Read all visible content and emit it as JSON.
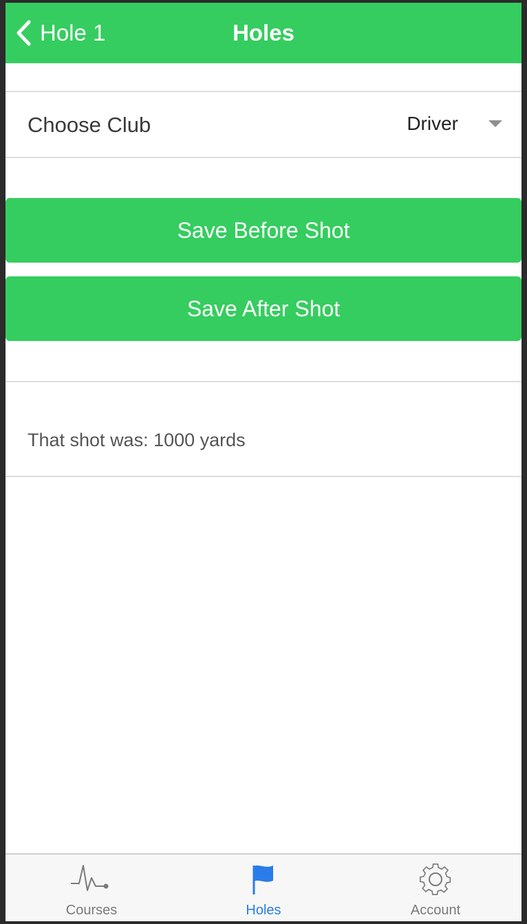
{
  "navbar": {
    "back_label": "Hole 1",
    "title": "Holes",
    "color": "#35cd5f"
  },
  "club": {
    "label": "Choose Club",
    "selected": "Driver"
  },
  "buttons": {
    "before": "Save Before Shot",
    "after": "Save After Shot"
  },
  "result": {
    "text": "That shot was: 1000 yards"
  },
  "tabs": [
    {
      "label": "Courses",
      "icon": "pulse-icon"
    },
    {
      "label": "Holes",
      "icon": "flag-icon",
      "active": true
    },
    {
      "label": "Account",
      "icon": "gear-icon"
    }
  ],
  "colors": {
    "accent": "#35cd5f",
    "tab_active": "#2b7ce9",
    "tab_inactive": "#7a7a7a"
  }
}
